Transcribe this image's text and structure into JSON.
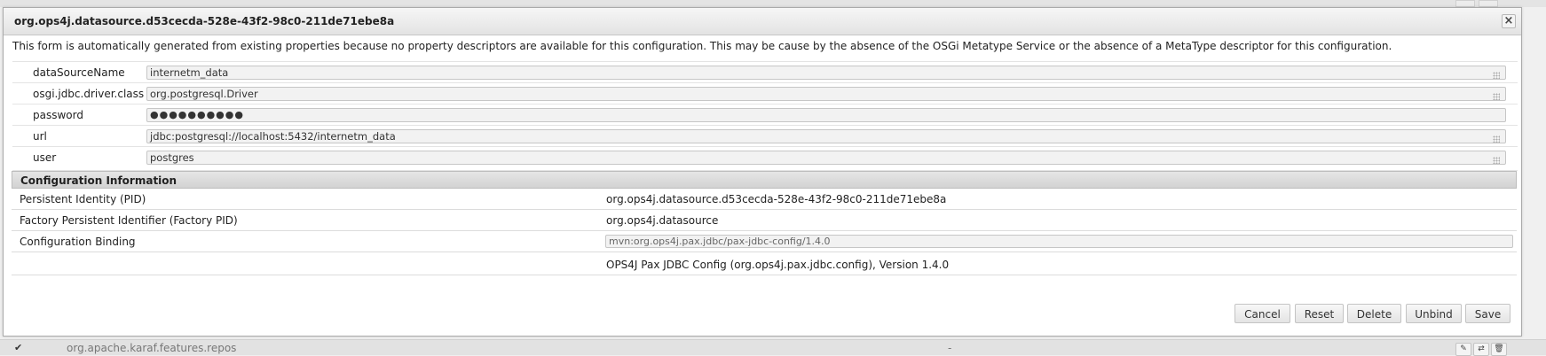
{
  "dialog": {
    "title": "org.ops4j.datasource.d53cecda-528e-43f2-98c0-211de71ebe8a",
    "close_glyph": "×",
    "notice": "This form is automatically generated from existing properties because no property descriptors are available for this configuration. This may be cause by the absence of the OSGi Metatype Service or the absence of a MetaType descriptor for this configuration."
  },
  "properties": [
    {
      "label": "dataSourceName",
      "value": "internetm_data"
    },
    {
      "label": "osgi.jdbc.driver.class",
      "value": "org.postgresql.Driver"
    },
    {
      "label": "password",
      "value": "●●●●●●●●●●"
    },
    {
      "label": "url",
      "value": "jdbc:postgresql://localhost:5432/internetm_data"
    },
    {
      "label": "user",
      "value": "postgres"
    }
  ],
  "config_info": {
    "header": "Configuration Information",
    "rows": [
      {
        "label": "Persistent Identity (PID)",
        "value": "org.ops4j.datasource.d53cecda-528e-43f2-98c0-211de71ebe8a"
      },
      {
        "label": "Factory Persistent Identifier (Factory PID)",
        "value": "org.ops4j.datasource"
      },
      {
        "label": "Configuration Binding",
        "value": "mvn:org.ops4j.pax.jdbc/pax-jdbc-config/1.4.0"
      },
      {
        "label": "",
        "value": "OPS4J Pax JDBC Config (org.ops4j.pax.jdbc.config), Version 1.4.0"
      }
    ]
  },
  "buttons": {
    "cancel": "Cancel",
    "reset": "Reset",
    "delete": "Delete",
    "unbind": "Unbind",
    "save": "Save"
  },
  "background_row": {
    "check": "✔",
    "name": "org.apache.karaf.features.repos",
    "factory": "-",
    "icons": [
      "pencil-icon",
      "unbind-icon",
      "trash-icon"
    ]
  }
}
